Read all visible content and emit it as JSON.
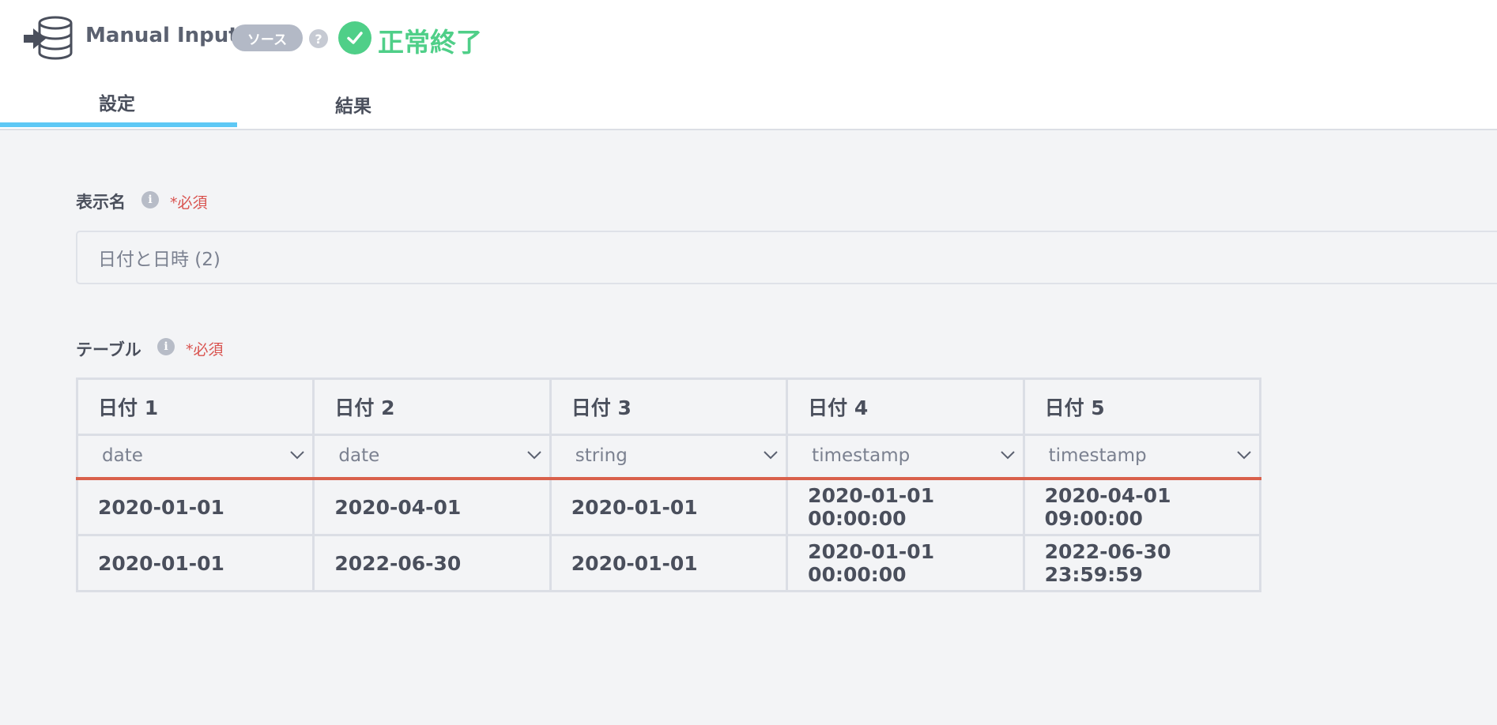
{
  "header": {
    "title": "Manual Input",
    "badge": "ソース",
    "help": "?",
    "status": "正常終了",
    "status_color": "#4fcf88"
  },
  "tabs": [
    {
      "label": "設定",
      "active": true
    },
    {
      "label": "結果",
      "active": false
    }
  ],
  "display_name": {
    "label": "表示名",
    "required": "*必須",
    "value": "日付と日時 (2)"
  },
  "table_section": {
    "label": "テーブル",
    "required": "*必須",
    "columns": [
      {
        "name": "日付 1",
        "type": "date"
      },
      {
        "name": "日付 2",
        "type": "date"
      },
      {
        "name": "日付 3",
        "type": "string"
      },
      {
        "name": "日付 4",
        "type": "timestamp"
      },
      {
        "name": "日付 5",
        "type": "timestamp"
      }
    ],
    "rows": [
      [
        "2020-01-01",
        "2020-04-01",
        "2020-01-01",
        "2020-01-01 00:00:00",
        "2020-04-01 09:00:00"
      ],
      [
        "2020-01-01",
        "2022-06-30",
        "2020-01-01",
        "2020-01-01 00:00:00",
        "2022-06-30 23:59:59"
      ]
    ]
  },
  "icons": {
    "node": "database-input-icon",
    "status": "check-circle-icon",
    "info": "info-icon",
    "dropdown": "chevron-down-icon"
  },
  "accent_colors": {
    "tab_underline": "#5ec8f5",
    "required": "#d9534f",
    "type_divider": "#d9604b"
  }
}
